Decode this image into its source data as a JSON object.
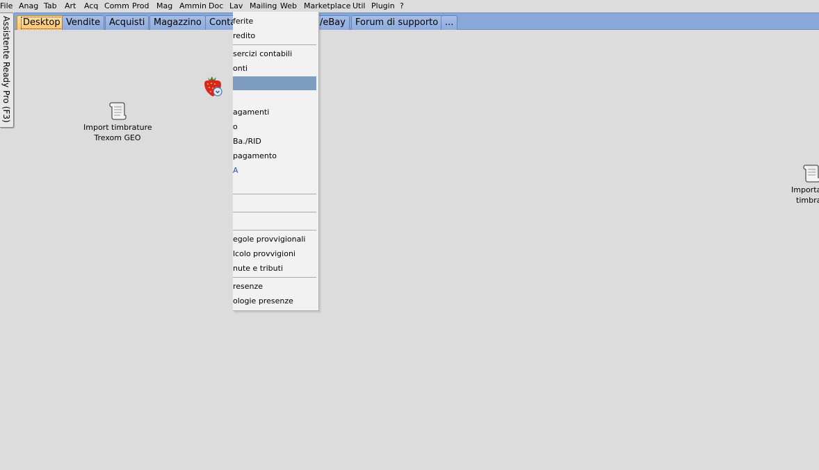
{
  "menubar": {
    "items": [
      "File",
      "Anag",
      "Tab",
      "Art",
      "Acq",
      "Comm",
      "Prod",
      "Mag",
      "Ammin",
      "Doc",
      "Lav",
      "Mailing",
      "Web",
      "Marketplace",
      "Util",
      "Plugin",
      "?"
    ]
  },
  "tabs": {
    "items": [
      "Desktop",
      "Vendite",
      "Acquisti",
      "Magazzino",
      "Conta",
      "/eBay",
      "Forum di supporto",
      "..."
    ],
    "active": "Desktop"
  },
  "sidebar": {
    "assistant_label": "Assistente Ready Pro (F3)"
  },
  "desktop": {
    "icon1": {
      "label_line1": "Import timbrature",
      "label_line2": "Trexom GEO",
      "icon": "scroll-icon"
    },
    "icon2": {
      "label_line1": "Importaz",
      "label_line2": "timbrat",
      "icon": "scroll-icon"
    },
    "strawberry": {
      "icon": "strawberry-clock-icon"
    }
  },
  "dropdown": {
    "items": [
      "ferite",
      "redito",
      "sercizi contabili",
      "onti",
      "",
      "agamenti",
      "o",
      "Ba./RID",
      "pagamento",
      "A",
      "",
      "",
      "egole provvigionali",
      "lcolo provvigioni",
      "nute e tributi",
      "resenze",
      "ologie presenze"
    ],
    "highlighted_index": 4
  },
  "colors": {
    "desktop_bg": "#dcdcdc",
    "tabbar_bg": "#88a8d8",
    "active_tab": "#ffc46c",
    "menu_highlight": "#7d9cc0"
  }
}
